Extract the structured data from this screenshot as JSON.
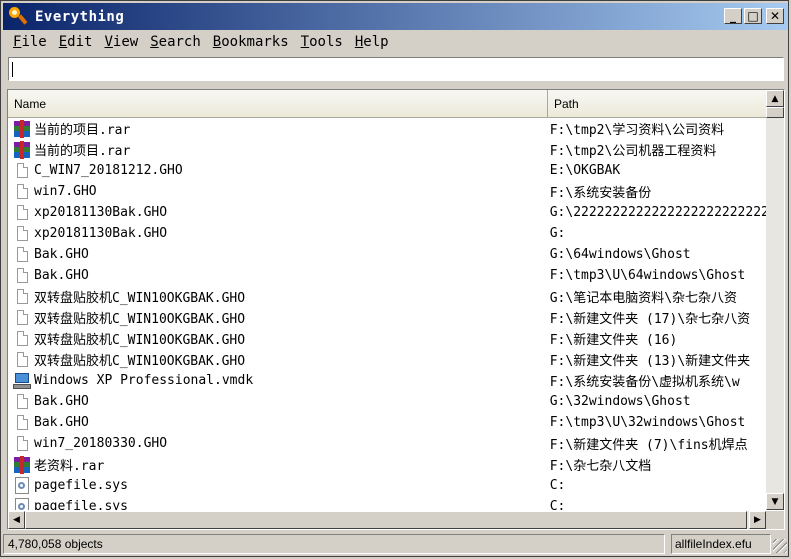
{
  "window": {
    "title": "Everything",
    "minimize": "_",
    "maximize": "□",
    "close": "✕"
  },
  "menu": [
    {
      "ul": "F",
      "rest": "ile"
    },
    {
      "ul": "E",
      "rest": "dit"
    },
    {
      "ul": "V",
      "rest": "iew"
    },
    {
      "ul": "S",
      "rest": "earch"
    },
    {
      "ul": "B",
      "rest": "ookmarks"
    },
    {
      "ul": "T",
      "rest": "ools"
    },
    {
      "ul": "H",
      "rest": "elp"
    }
  ],
  "search": {
    "value": ""
  },
  "columns": {
    "name": "Name",
    "path": "Path"
  },
  "rows": [
    {
      "icon": "rar-icon",
      "name": "当前的项目.rar",
      "path": "F:\\tmp2\\学习资料\\公司资料"
    },
    {
      "icon": "rar-icon",
      "name": "当前的项目.rar",
      "path": "F:\\tmp2\\公司机器工程资料"
    },
    {
      "icon": "document-icon",
      "name": "C_WIN7_20181212.GHO",
      "path": "E:\\OKGBAK"
    },
    {
      "icon": "document-icon",
      "name": "win7.GHO",
      "path": "F:\\系统安装备份"
    },
    {
      "icon": "document-icon",
      "name": "xp20181130Bak.GHO",
      "path": "G:\\2222222222222222222222222"
    },
    {
      "icon": "document-icon",
      "name": "xp20181130Bak.GHO",
      "path": "G:"
    },
    {
      "icon": "document-icon",
      "name": "Bak.GHO",
      "path": "G:\\64windows\\Ghost"
    },
    {
      "icon": "document-icon",
      "name": "Bak.GHO",
      "path": "F:\\tmp3\\U\\64windows\\Ghost"
    },
    {
      "icon": "document-icon",
      "name": "双转盘贴胶机C_WIN10OKGBAK.GHO",
      "path": "G:\\笔记本电脑资料\\杂七杂八资"
    },
    {
      "icon": "document-icon",
      "name": "双转盘贴胶机C_WIN10OKGBAK.GHO",
      "path": "F:\\新建文件夹 (17)\\杂七杂八资"
    },
    {
      "icon": "document-icon",
      "name": "双转盘贴胶机C_WIN10OKGBAK.GHO",
      "path": "F:\\新建文件夹 (16)"
    },
    {
      "icon": "document-icon",
      "name": "双转盘贴胶机C_WIN10OKGBAK.GHO",
      "path": "F:\\新建文件夹 (13)\\新建文件夹"
    },
    {
      "icon": "vmdk-icon",
      "name": "Windows XP Professional.vmdk",
      "path": "F:\\系统安装备份\\虚拟机系统\\w"
    },
    {
      "icon": "document-icon",
      "name": "Bak.GHO",
      "path": "G:\\32windows\\Ghost"
    },
    {
      "icon": "document-icon",
      "name": "Bak.GHO",
      "path": "F:\\tmp3\\U\\32windows\\Ghost"
    },
    {
      "icon": "document-icon",
      "name": "win7_20180330.GHO",
      "path": "F:\\新建文件夹 (7)\\fins机焊点"
    },
    {
      "icon": "rar-icon",
      "name": "老资料.rar",
      "path": "F:\\杂七杂八文档"
    },
    {
      "icon": "sys-file-icon",
      "name": "pagefile.sys",
      "path": "C:"
    },
    {
      "icon": "sys-file-icon",
      "name": "pagefile.sys",
      "path": "C:"
    }
  ],
  "scrollbar": {
    "up": "▲",
    "down": "▼",
    "left": "◀",
    "right": "▶"
  },
  "status": {
    "count": "4,780,058 objects",
    "file": "allfileIndex.efu"
  }
}
